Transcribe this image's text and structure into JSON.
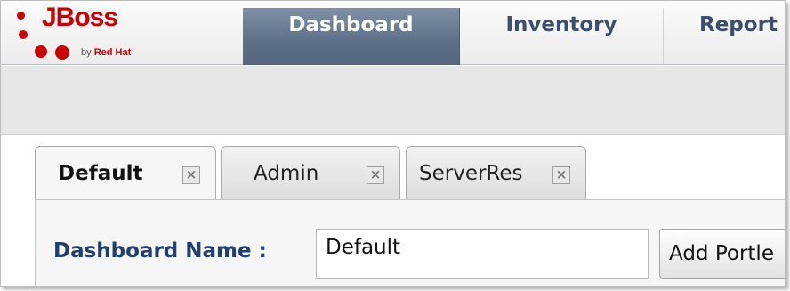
{
  "logo": {
    "brand": "JBoss",
    "byline_prefix": "by",
    "byline_company": "Red Hat",
    "color": "#cc0000"
  },
  "nav": {
    "items": [
      {
        "label": "Dashboard",
        "active": true
      },
      {
        "label": "Inventory",
        "active": false
      },
      {
        "label": "Report",
        "active": false
      }
    ]
  },
  "tabs": [
    {
      "label": "Default",
      "active": true,
      "close_icon": "close-box-icon",
      "close_glyph": "×"
    },
    {
      "label": "Admin",
      "active": false,
      "close_icon": "close-box-icon",
      "close_glyph": "×"
    },
    {
      "label": "ServerRes",
      "active": false,
      "close_icon": "close-box-icon",
      "close_glyph": "×"
    }
  ],
  "dashboard_form": {
    "name_label": "Dashboard Name :",
    "name_value": "Default",
    "add_button_label": "Add Portle"
  },
  "colors": {
    "nav_active_bg": "#5d6f86",
    "nav_text": "#3c4f6a",
    "label_text": "#21406e"
  }
}
